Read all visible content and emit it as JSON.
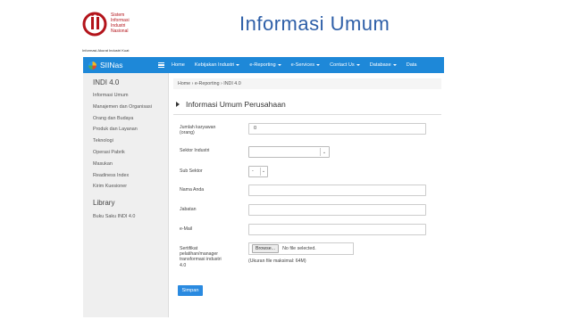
{
  "logo": {
    "lines": [
      "Sistem",
      "Informasi",
      "Industri",
      "Nasional"
    ],
    "tagline": "Informasi Akurat Industri Kuat"
  },
  "slide_title": "Informasi Umum",
  "navbar": {
    "brand": "SIINas",
    "items": [
      {
        "label": "Home",
        "dropdown": false
      },
      {
        "label": "Kebijakan Industri",
        "dropdown": true
      },
      {
        "label": "e-Reporting",
        "dropdown": true
      },
      {
        "label": "e-Services",
        "dropdown": true
      },
      {
        "label": "Contact Us",
        "dropdown": true
      },
      {
        "label": "Database",
        "dropdown": true
      },
      {
        "label": "Data",
        "dropdown": false
      }
    ]
  },
  "sidebar": {
    "heading": "INDI 4.0",
    "items": [
      "Informasi Umum",
      "Manajemen dan Organisasi",
      "Orang dan Budaya",
      "Produk dan Layanan",
      "Teknologi",
      "Operasi Pabrik",
      "Masukan",
      "Readiness Index",
      "Kirim Kuesioner"
    ],
    "heading2": "Library",
    "items2": [
      "Buku Saku INDI 4.0"
    ]
  },
  "breadcrumb": "Home › e-Reporting › INDI 4.0",
  "section_title": "Informasi Umum Perusahaan",
  "form": {
    "jumlah_label_1": "Jumlah karyawan",
    "jumlah_label_2": "(orang)",
    "jumlah_value": "0",
    "sektor_label": "Sektor Industri",
    "subsektor_label": "Sub Sektor",
    "subsektor_value": "-",
    "nama_label": "Nama Anda",
    "jabatan_label": "Jabatan",
    "email_label": "e-Mail",
    "sertifikat_label": [
      "Sertifikat",
      "pelatihan/manager",
      "transformasi industri",
      "4.0"
    ],
    "browse_label": "Browse...",
    "file_status": "No file selected.",
    "file_hint": "(Ukuran file maksimal: 64M)",
    "submit_label": "Simpan"
  },
  "colors": {
    "navbar": "#1e88d8",
    "title": "#2e5fa8",
    "button": "#2a8ae0",
    "logo_red": "#b3141b"
  }
}
